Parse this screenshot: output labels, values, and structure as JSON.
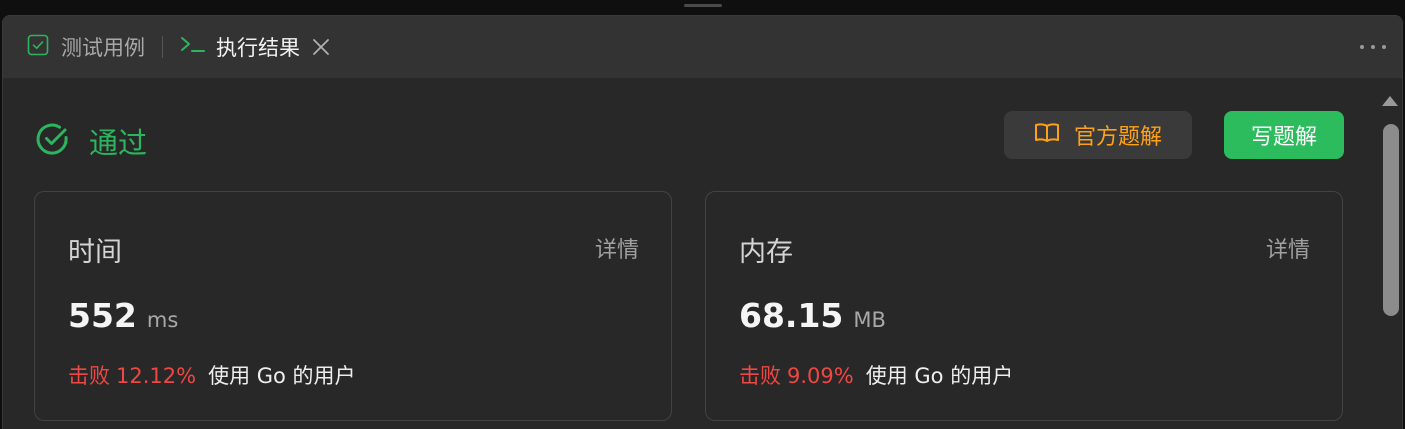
{
  "tabs": {
    "test_cases_label": "测试用例",
    "result_label": "执行结果"
  },
  "status": {
    "text": "通过",
    "color": "#2db55d"
  },
  "buttons": {
    "official_solution_label": "官方题解",
    "write_solution_label": "写题解"
  },
  "cards": {
    "time": {
      "title": "时间",
      "detail_label": "详情",
      "value": "552",
      "unit": "ms",
      "beats_prefix": "击败",
      "beats_percent": "12.12%",
      "beats_suffix": "使用 Go 的用户"
    },
    "memory": {
      "title": "内存",
      "detail_label": "详情",
      "value": "68.15",
      "unit": "MB",
      "beats_prefix": "击败",
      "beats_percent": "9.09%",
      "beats_suffix": "使用 Go 的用户"
    }
  },
  "icons": {
    "test_cases_tab": "checkbox-icon",
    "result_tab": "terminal-icon",
    "close": "close-icon",
    "more": "more-horizontal-icon",
    "status": "check-circle-icon",
    "solution": "book-open-icon"
  },
  "colors": {
    "accent_green": "#2cbb5d",
    "accent_orange": "#ffa116",
    "beats_red": "#ef4743"
  }
}
